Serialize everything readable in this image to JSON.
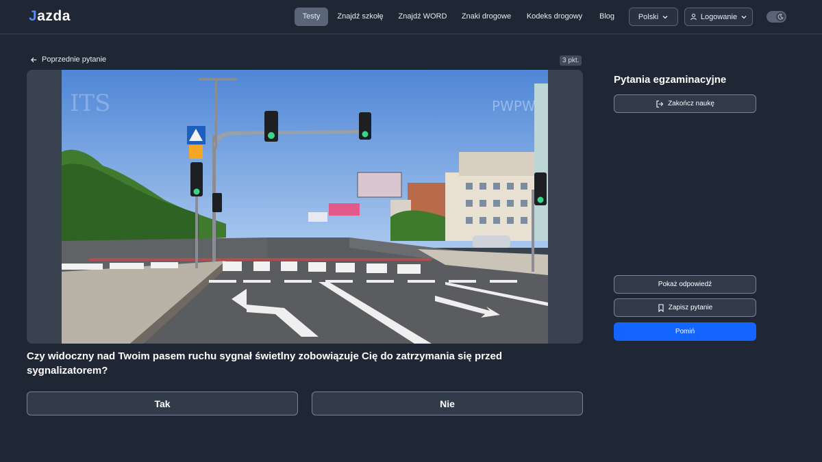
{
  "header": {
    "logo": "azda",
    "nav": [
      {
        "label": "Testy",
        "active": true
      },
      {
        "label": "Znajdź szkołę",
        "active": false
      },
      {
        "label": "Znajdź WORD",
        "active": false
      },
      {
        "label": "Znaki drogowe",
        "active": false
      },
      {
        "label": "Kodeks drogowy",
        "active": false
      },
      {
        "label": "Blog",
        "active": false
      }
    ],
    "language": "Polski",
    "login": "Logowanie"
  },
  "question_panel": {
    "back_label": "Poprzednie pytanie",
    "points": "3 pkt.",
    "question": "Czy widoczny nad Twoim pasem ruchu sygnał świetlny zobowiązuje Cię do zatrzymania się przed sygnalizatorem?",
    "answers": [
      "Tak",
      "Nie"
    ]
  },
  "sidebar": {
    "title": "Pytania egzaminacyjne",
    "finish_label": "Zakończ naukę",
    "show_answer_label": "Pokaż odpowiedź",
    "save_label": "Zapisz pytanie",
    "skip_label": "Pomiń"
  },
  "colors": {
    "background": "#1f2634",
    "accent": "#1464ff",
    "logo_accent": "#4d8dff"
  }
}
